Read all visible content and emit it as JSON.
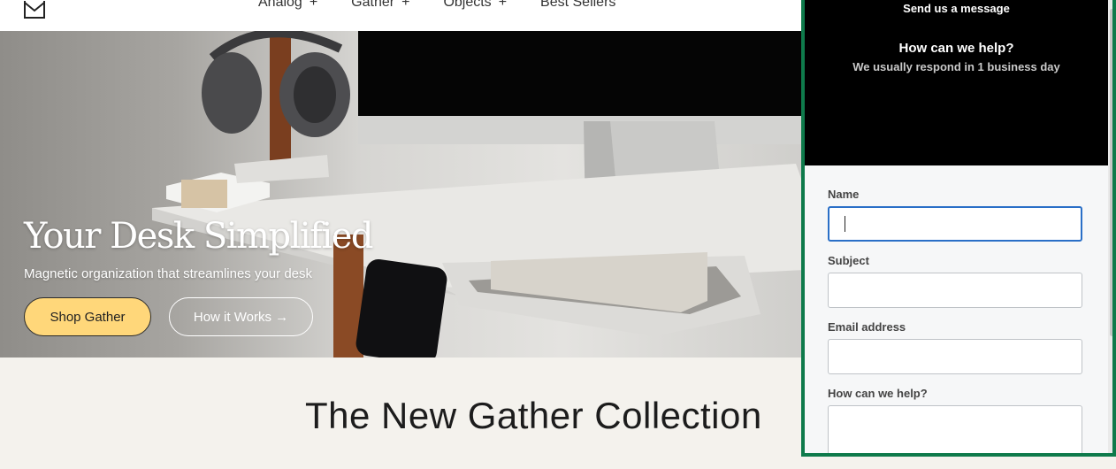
{
  "header": {
    "logo_icon": "envelope-logo-icon",
    "nav": [
      {
        "label": "Analog",
        "plus": "+"
      },
      {
        "label": "Gather",
        "plus": "+"
      },
      {
        "label": "Objects",
        "plus": "+"
      },
      {
        "label": "Best Sellers"
      }
    ]
  },
  "hero": {
    "title": "Your Desk Simplified",
    "subtitle": "Magnetic organization that streamlines your desk",
    "shop_button": "Shop Gather",
    "how_button": "How it Works →",
    "shop_button_color": "#ffd77a"
  },
  "section": {
    "title": "The New Gather Collection"
  },
  "contact_widget": {
    "header_label": "Send us a message",
    "heading": "How can we help?",
    "response_note": "We usually respond in 1 business day",
    "accent_color": "#0e7a4b",
    "fields": {
      "name_label": "Name",
      "name_value": "",
      "subject_label": "Subject",
      "subject_value": "",
      "email_label": "Email address",
      "email_value": "",
      "message_label": "How can we help?",
      "message_value": ""
    }
  }
}
